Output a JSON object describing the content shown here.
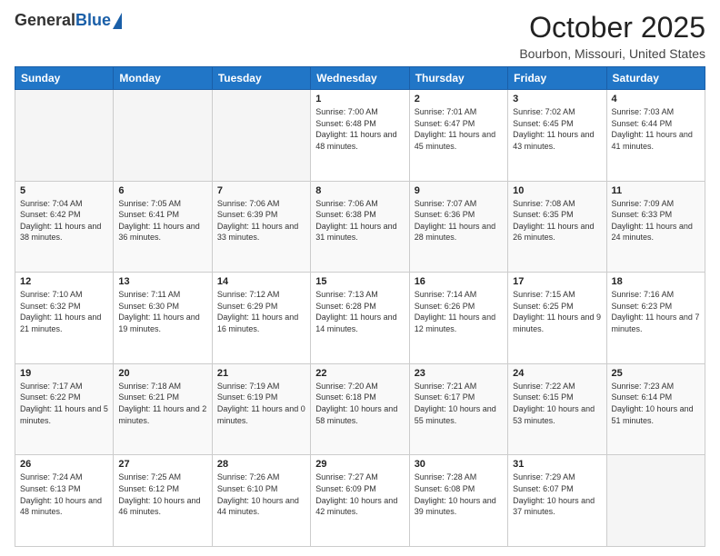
{
  "header": {
    "logo_general": "General",
    "logo_blue": "Blue",
    "month": "October 2025",
    "location": "Bourbon, Missouri, United States"
  },
  "weekdays": [
    "Sunday",
    "Monday",
    "Tuesday",
    "Wednesday",
    "Thursday",
    "Friday",
    "Saturday"
  ],
  "weeks": [
    [
      {
        "day": "",
        "sunrise": "",
        "sunset": "",
        "daylight": ""
      },
      {
        "day": "",
        "sunrise": "",
        "sunset": "",
        "daylight": ""
      },
      {
        "day": "",
        "sunrise": "",
        "sunset": "",
        "daylight": ""
      },
      {
        "day": "1",
        "sunrise": "Sunrise: 7:00 AM",
        "sunset": "Sunset: 6:48 PM",
        "daylight": "Daylight: 11 hours and 48 minutes."
      },
      {
        "day": "2",
        "sunrise": "Sunrise: 7:01 AM",
        "sunset": "Sunset: 6:47 PM",
        "daylight": "Daylight: 11 hours and 45 minutes."
      },
      {
        "day": "3",
        "sunrise": "Sunrise: 7:02 AM",
        "sunset": "Sunset: 6:45 PM",
        "daylight": "Daylight: 11 hours and 43 minutes."
      },
      {
        "day": "4",
        "sunrise": "Sunrise: 7:03 AM",
        "sunset": "Sunset: 6:44 PM",
        "daylight": "Daylight: 11 hours and 41 minutes."
      }
    ],
    [
      {
        "day": "5",
        "sunrise": "Sunrise: 7:04 AM",
        "sunset": "Sunset: 6:42 PM",
        "daylight": "Daylight: 11 hours and 38 minutes."
      },
      {
        "day": "6",
        "sunrise": "Sunrise: 7:05 AM",
        "sunset": "Sunset: 6:41 PM",
        "daylight": "Daylight: 11 hours and 36 minutes."
      },
      {
        "day": "7",
        "sunrise": "Sunrise: 7:06 AM",
        "sunset": "Sunset: 6:39 PM",
        "daylight": "Daylight: 11 hours and 33 minutes."
      },
      {
        "day": "8",
        "sunrise": "Sunrise: 7:06 AM",
        "sunset": "Sunset: 6:38 PM",
        "daylight": "Daylight: 11 hours and 31 minutes."
      },
      {
        "day": "9",
        "sunrise": "Sunrise: 7:07 AM",
        "sunset": "Sunset: 6:36 PM",
        "daylight": "Daylight: 11 hours and 28 minutes."
      },
      {
        "day": "10",
        "sunrise": "Sunrise: 7:08 AM",
        "sunset": "Sunset: 6:35 PM",
        "daylight": "Daylight: 11 hours and 26 minutes."
      },
      {
        "day": "11",
        "sunrise": "Sunrise: 7:09 AM",
        "sunset": "Sunset: 6:33 PM",
        "daylight": "Daylight: 11 hours and 24 minutes."
      }
    ],
    [
      {
        "day": "12",
        "sunrise": "Sunrise: 7:10 AM",
        "sunset": "Sunset: 6:32 PM",
        "daylight": "Daylight: 11 hours and 21 minutes."
      },
      {
        "day": "13",
        "sunrise": "Sunrise: 7:11 AM",
        "sunset": "Sunset: 6:30 PM",
        "daylight": "Daylight: 11 hours and 19 minutes."
      },
      {
        "day": "14",
        "sunrise": "Sunrise: 7:12 AM",
        "sunset": "Sunset: 6:29 PM",
        "daylight": "Daylight: 11 hours and 16 minutes."
      },
      {
        "day": "15",
        "sunrise": "Sunrise: 7:13 AM",
        "sunset": "Sunset: 6:28 PM",
        "daylight": "Daylight: 11 hours and 14 minutes."
      },
      {
        "day": "16",
        "sunrise": "Sunrise: 7:14 AM",
        "sunset": "Sunset: 6:26 PM",
        "daylight": "Daylight: 11 hours and 12 minutes."
      },
      {
        "day": "17",
        "sunrise": "Sunrise: 7:15 AM",
        "sunset": "Sunset: 6:25 PM",
        "daylight": "Daylight: 11 hours and 9 minutes."
      },
      {
        "day": "18",
        "sunrise": "Sunrise: 7:16 AM",
        "sunset": "Sunset: 6:23 PM",
        "daylight": "Daylight: 11 hours and 7 minutes."
      }
    ],
    [
      {
        "day": "19",
        "sunrise": "Sunrise: 7:17 AM",
        "sunset": "Sunset: 6:22 PM",
        "daylight": "Daylight: 11 hours and 5 minutes."
      },
      {
        "day": "20",
        "sunrise": "Sunrise: 7:18 AM",
        "sunset": "Sunset: 6:21 PM",
        "daylight": "Daylight: 11 hours and 2 minutes."
      },
      {
        "day": "21",
        "sunrise": "Sunrise: 7:19 AM",
        "sunset": "Sunset: 6:19 PM",
        "daylight": "Daylight: 11 hours and 0 minutes."
      },
      {
        "day": "22",
        "sunrise": "Sunrise: 7:20 AM",
        "sunset": "Sunset: 6:18 PM",
        "daylight": "Daylight: 10 hours and 58 minutes."
      },
      {
        "day": "23",
        "sunrise": "Sunrise: 7:21 AM",
        "sunset": "Sunset: 6:17 PM",
        "daylight": "Daylight: 10 hours and 55 minutes."
      },
      {
        "day": "24",
        "sunrise": "Sunrise: 7:22 AM",
        "sunset": "Sunset: 6:15 PM",
        "daylight": "Daylight: 10 hours and 53 minutes."
      },
      {
        "day": "25",
        "sunrise": "Sunrise: 7:23 AM",
        "sunset": "Sunset: 6:14 PM",
        "daylight": "Daylight: 10 hours and 51 minutes."
      }
    ],
    [
      {
        "day": "26",
        "sunrise": "Sunrise: 7:24 AM",
        "sunset": "Sunset: 6:13 PM",
        "daylight": "Daylight: 10 hours and 48 minutes."
      },
      {
        "day": "27",
        "sunrise": "Sunrise: 7:25 AM",
        "sunset": "Sunset: 6:12 PM",
        "daylight": "Daylight: 10 hours and 46 minutes."
      },
      {
        "day": "28",
        "sunrise": "Sunrise: 7:26 AM",
        "sunset": "Sunset: 6:10 PM",
        "daylight": "Daylight: 10 hours and 44 minutes."
      },
      {
        "day": "29",
        "sunrise": "Sunrise: 7:27 AM",
        "sunset": "Sunset: 6:09 PM",
        "daylight": "Daylight: 10 hours and 42 minutes."
      },
      {
        "day": "30",
        "sunrise": "Sunrise: 7:28 AM",
        "sunset": "Sunset: 6:08 PM",
        "daylight": "Daylight: 10 hours and 39 minutes."
      },
      {
        "day": "31",
        "sunrise": "Sunrise: 7:29 AM",
        "sunset": "Sunset: 6:07 PM",
        "daylight": "Daylight: 10 hours and 37 minutes."
      },
      {
        "day": "",
        "sunrise": "",
        "sunset": "",
        "daylight": ""
      }
    ]
  ]
}
